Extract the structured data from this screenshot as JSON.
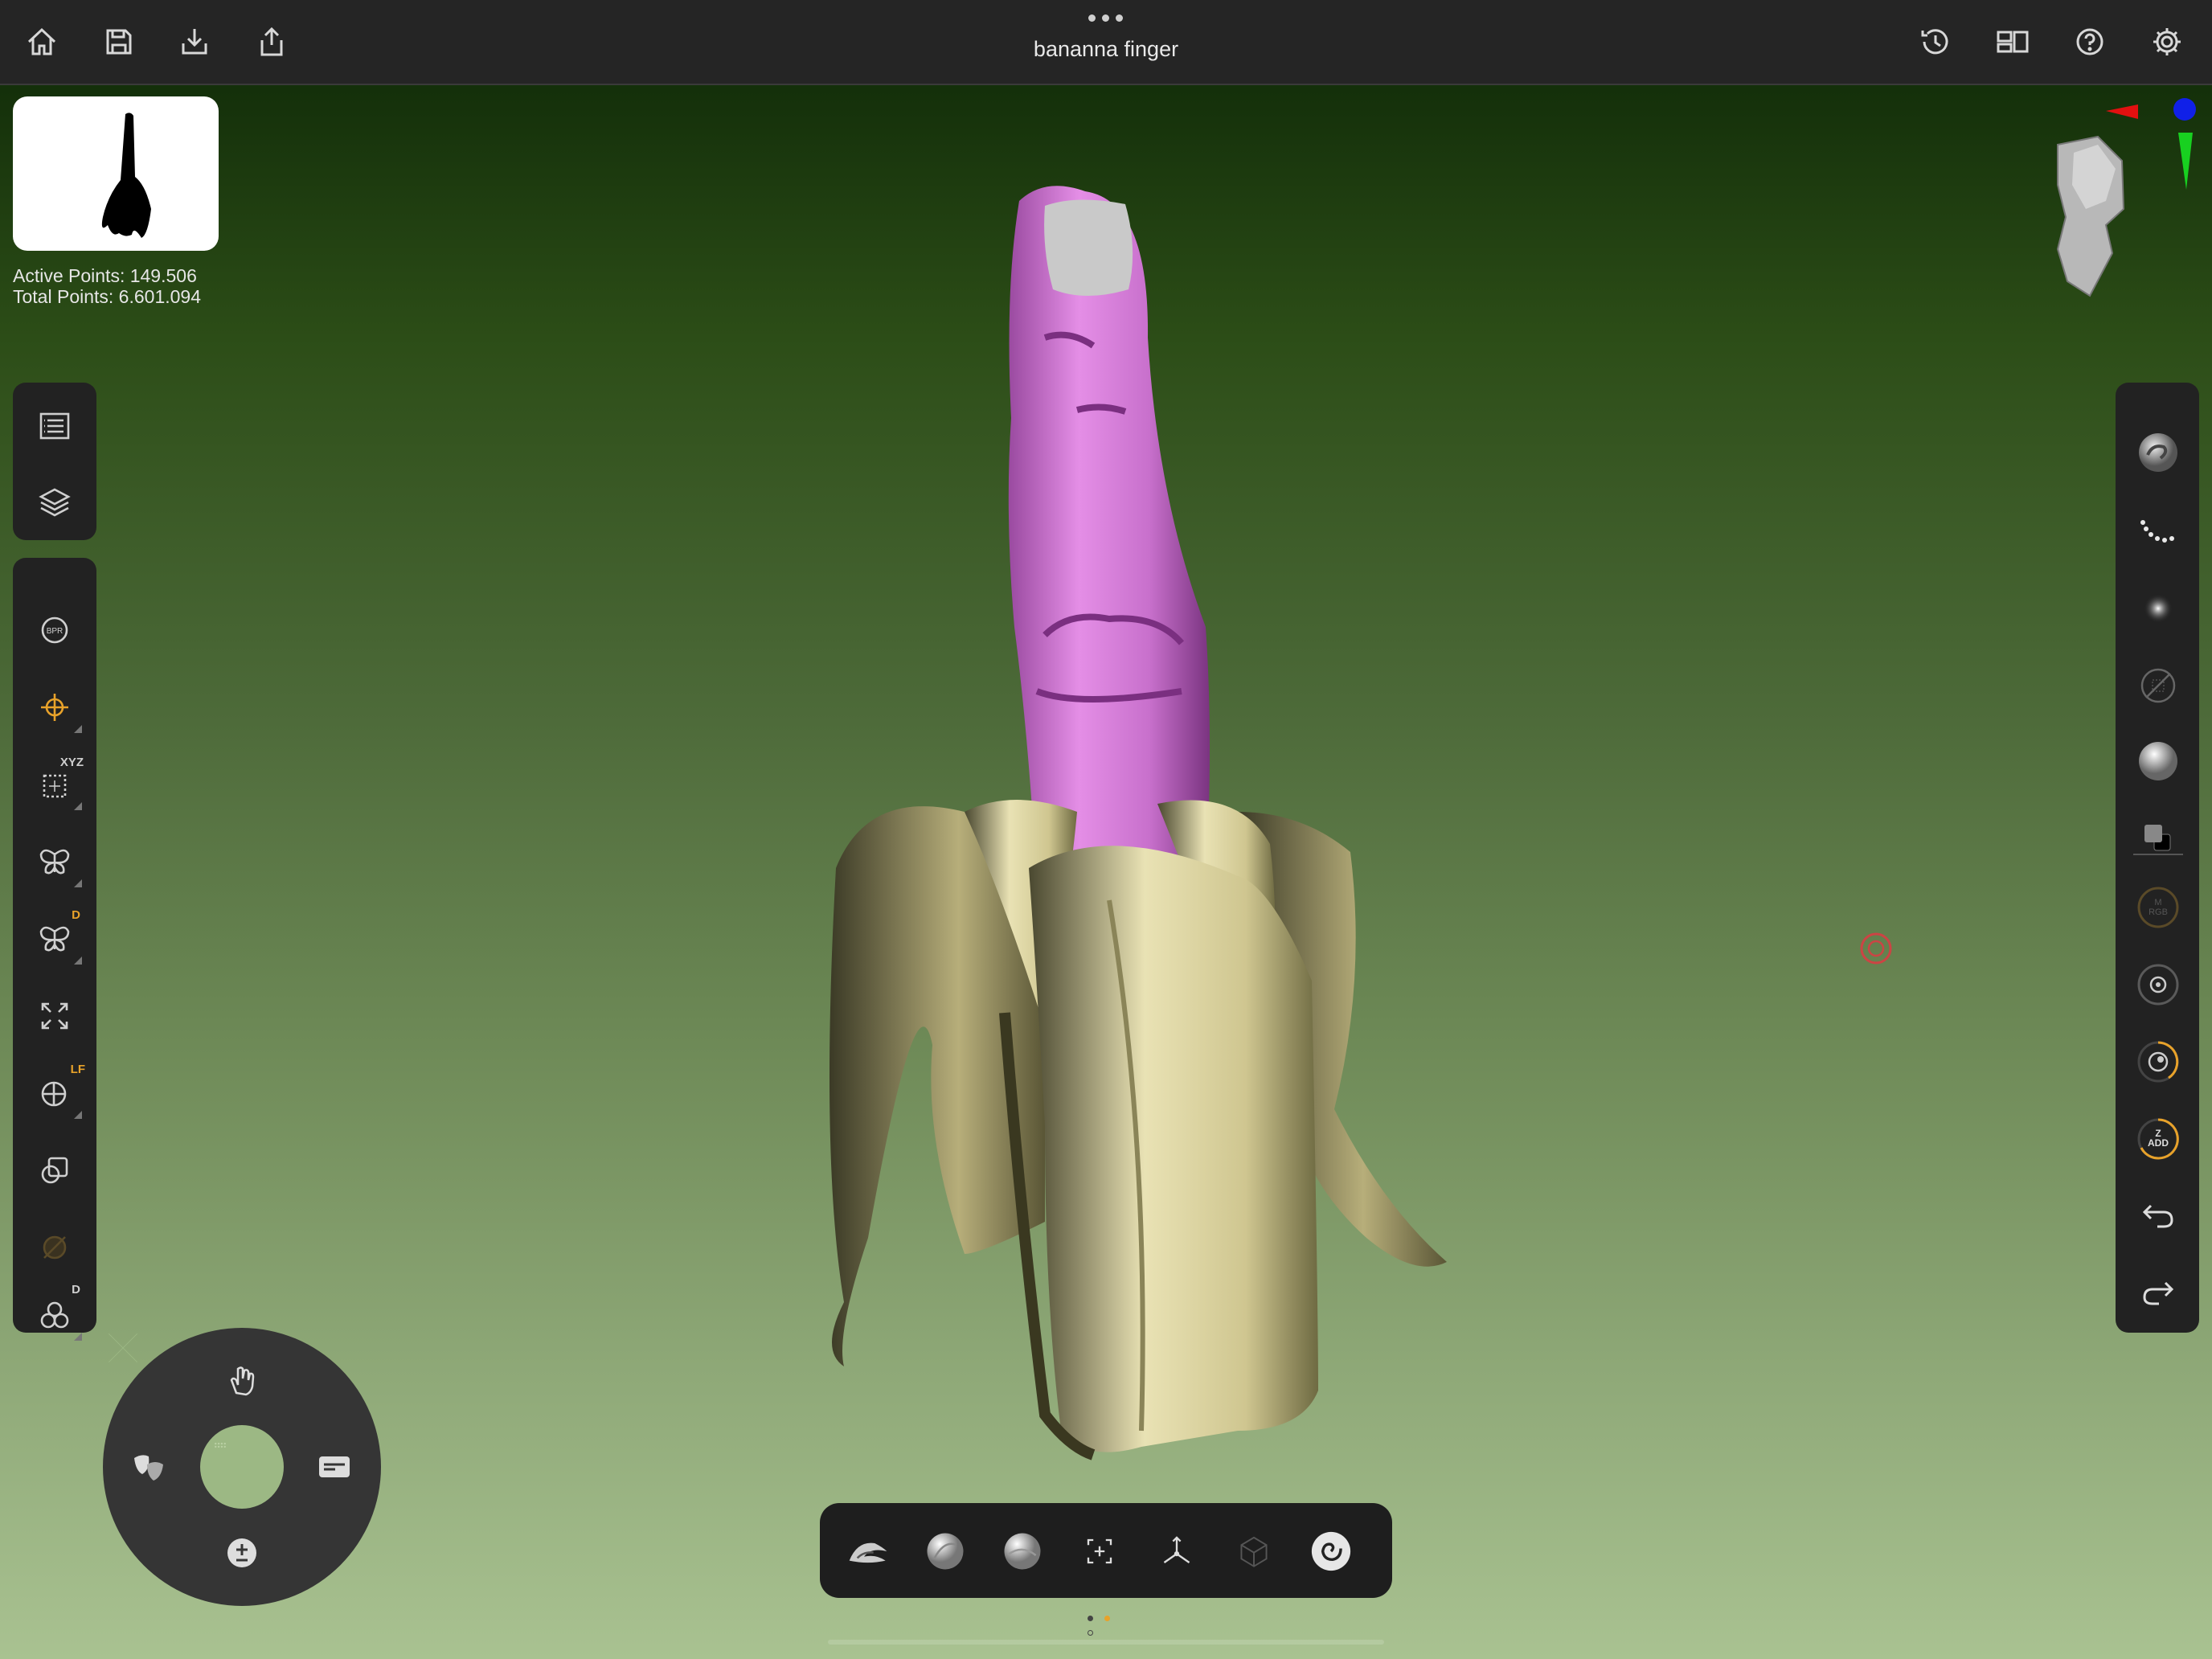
{
  "document": {
    "title": "bananna finger"
  },
  "stats": {
    "active_points": "Active Points: 149.506",
    "total_points": "Total Points: 6.601.094"
  },
  "top_left_tools": [
    "home-icon",
    "save-icon",
    "import-icon",
    "export-icon"
  ],
  "top_right_tools": [
    "history-icon",
    "layout-icon",
    "help-icon",
    "settings-icon"
  ],
  "left_panel_top": [
    "menu-icon",
    "layers-icon"
  ],
  "left_panel_tools": [
    {
      "icon": "bpr-icon",
      "label": "BPR"
    },
    {
      "icon": "gizmo-icon",
      "label": ""
    },
    {
      "icon": "symmetry-xyz-icon",
      "label": "XYZ"
    },
    {
      "icon": "mirror-icon",
      "label": ""
    },
    {
      "icon": "mirror-dynamic-icon",
      "label": "D"
    },
    {
      "icon": "frame-icon",
      "label": ""
    },
    {
      "icon": "floor-icon",
      "label": "LF"
    },
    {
      "icon": "transparency-icon",
      "label": ""
    },
    {
      "icon": "polyframe-icon",
      "label": ""
    },
    {
      "icon": "dynamic-subdiv-icon",
      "label": "D"
    }
  ],
  "right_panel": {
    "items": [
      "brush-preview",
      "stroke-icon",
      "alpha-icon",
      "texture-off-icon",
      "material-icon",
      "color-swatch",
      "rgb-toggle",
      "focal-shift",
      "draw-size",
      "z-intensity",
      "undo-icon",
      "redo-icon"
    ],
    "m_rgb_line1": "M",
    "m_rgb_line2": "RGB",
    "z_add_line1": "Z",
    "z_add_line2": "ADD"
  },
  "bottom_toolbar": [
    "mask-brush",
    "clay-brush",
    "standard-brush",
    "transform-icon",
    "move-axis-icon",
    "cube-icon",
    "spiral-brush"
  ],
  "pager": {
    "pages": 3,
    "active": 1
  },
  "colors": {
    "accent": "#e8a22a",
    "panel": "#222222",
    "topbar": "#252525"
  }
}
